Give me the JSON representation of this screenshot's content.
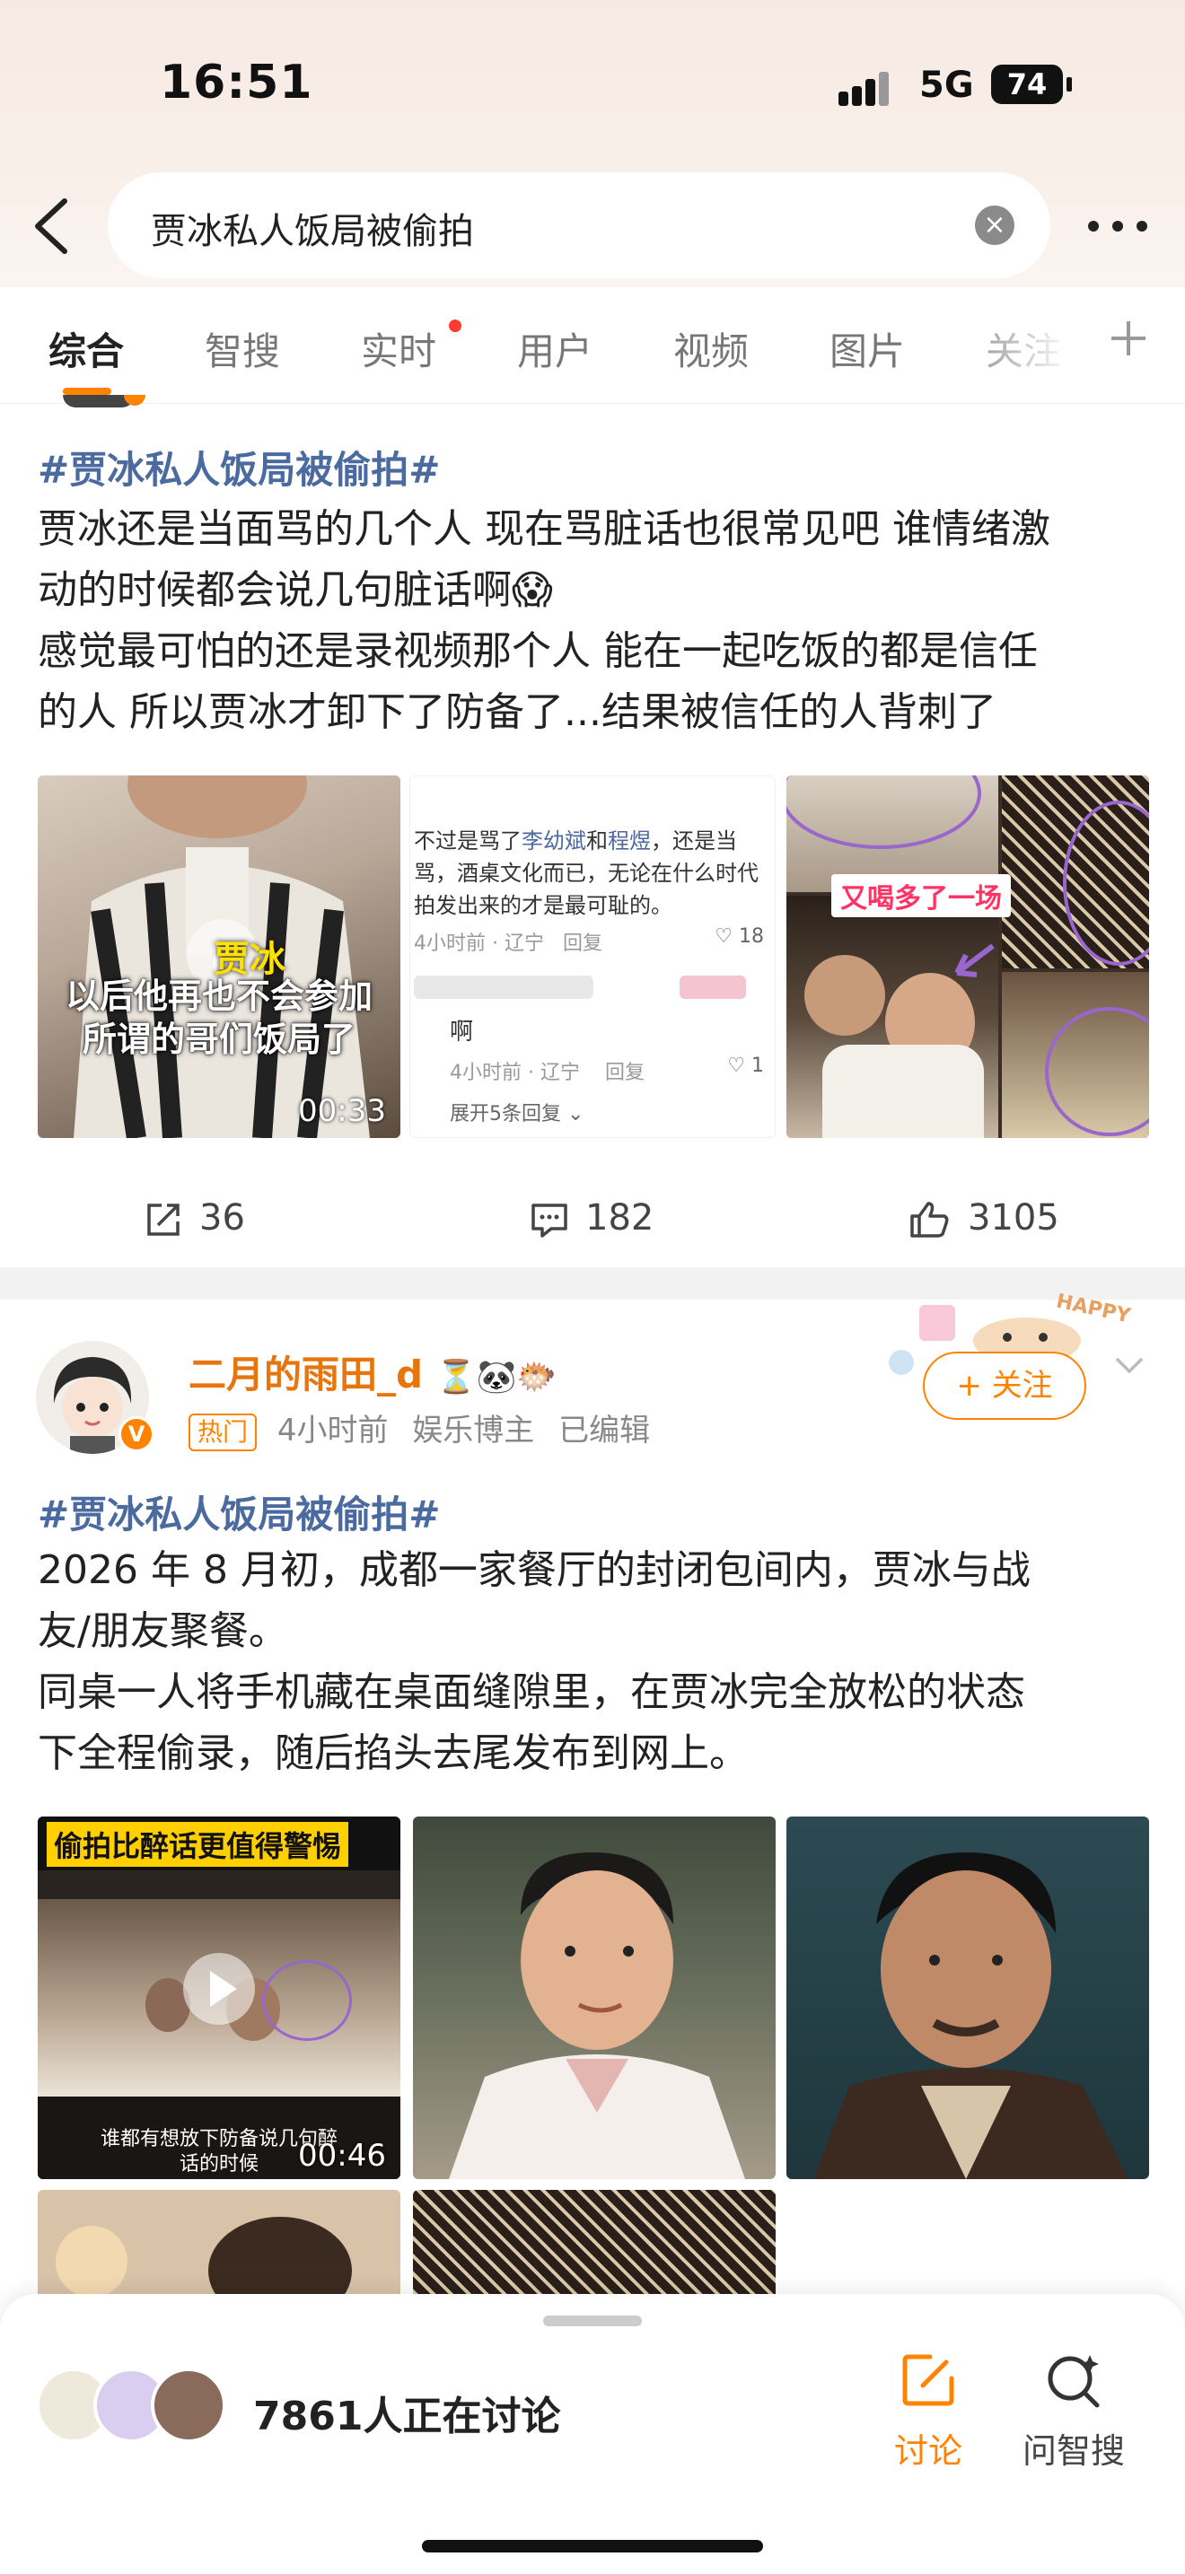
{
  "status_bar": {
    "time": "16:51",
    "network": "5G",
    "battery": "74"
  },
  "search": {
    "query": "贾冰私人饭局被偷拍",
    "clear_label": "×"
  },
  "tabs": [
    {
      "label": "综合"
    },
    {
      "label": "智搜"
    },
    {
      "label": "实时"
    },
    {
      "label": "用户"
    },
    {
      "label": "视频"
    },
    {
      "label": "图片"
    },
    {
      "label": "关注"
    }
  ],
  "post1": {
    "hashtag": "#贾冰私人饭局被偷拍#",
    "lines": [
      "贾冰还是当面骂的几个人 现在骂脏话也很常见吧 谁情绪激",
      "动的时候都会说几句脏话啊😱",
      "感觉最可怕的还是录视频那个人 能在一起吃饭的都是信任",
      "的人 所以贾冰才卸下了防备了...结果被信任的人背刺了"
    ],
    "video": {
      "caption_line1": "以后他再也不会参加",
      "caption_line2": "所谓的哥们饭局了",
      "duration": "00:33",
      "name_overlay": "贾冰"
    },
    "comment_screenshot": {
      "line1_pre": "不过是骂了",
      "name1": "李幼斌",
      "mid": "和",
      "name2": "程煜",
      "line1_post": "，还是当",
      "line2": "骂，酒桌文化而已，无论在什么时代",
      "line3": "拍发出来的才是最可耻的。",
      "meta1": "4小时前 · 辽宁",
      "reply1": "回复",
      "likes1": "18",
      "comment2": "啊",
      "meta2": "4小时前 · 辽宁",
      "reply2": "回复",
      "likes2": "1",
      "expand": "展开5条回复"
    },
    "collage_caption": "又喝多了一场",
    "actions": {
      "reposts": "36",
      "comments": "182",
      "likes": "3105"
    }
  },
  "post2": {
    "username": "二月的雨田_d",
    "badge": "热门",
    "time": "4小时前",
    "role": "娱乐博主",
    "edited": "已编辑",
    "follow_label": "+ 关注",
    "decor_text": "HAPPY",
    "hashtag": "#贾冰私人饭局被偷拍#",
    "lines": [
      "2026 年 8 月初，成都一家餐厅的封闭包间内，贾冰与战",
      "友/朋友聚餐。",
      "同桌一人将手机藏在桌面缝隙里，在贾冰完全放松的状态",
      "下全程偷录，随后掐头去尾发布到网上。"
    ],
    "video": {
      "top_caption": "偷拍比醉话更值得警惕",
      "bottom_caption_1": "谁都有想放下防备说几句醉",
      "bottom_caption_2": "话的时候",
      "duration": "00:46"
    }
  },
  "bottom_bar": {
    "discussing": "7861人正在讨论",
    "discuss_label": "讨论",
    "ask_label": "问智搜"
  },
  "colors": {
    "accent": "#ff8200",
    "hashtag": "#4b6aa0",
    "username": "#e8740c"
  }
}
